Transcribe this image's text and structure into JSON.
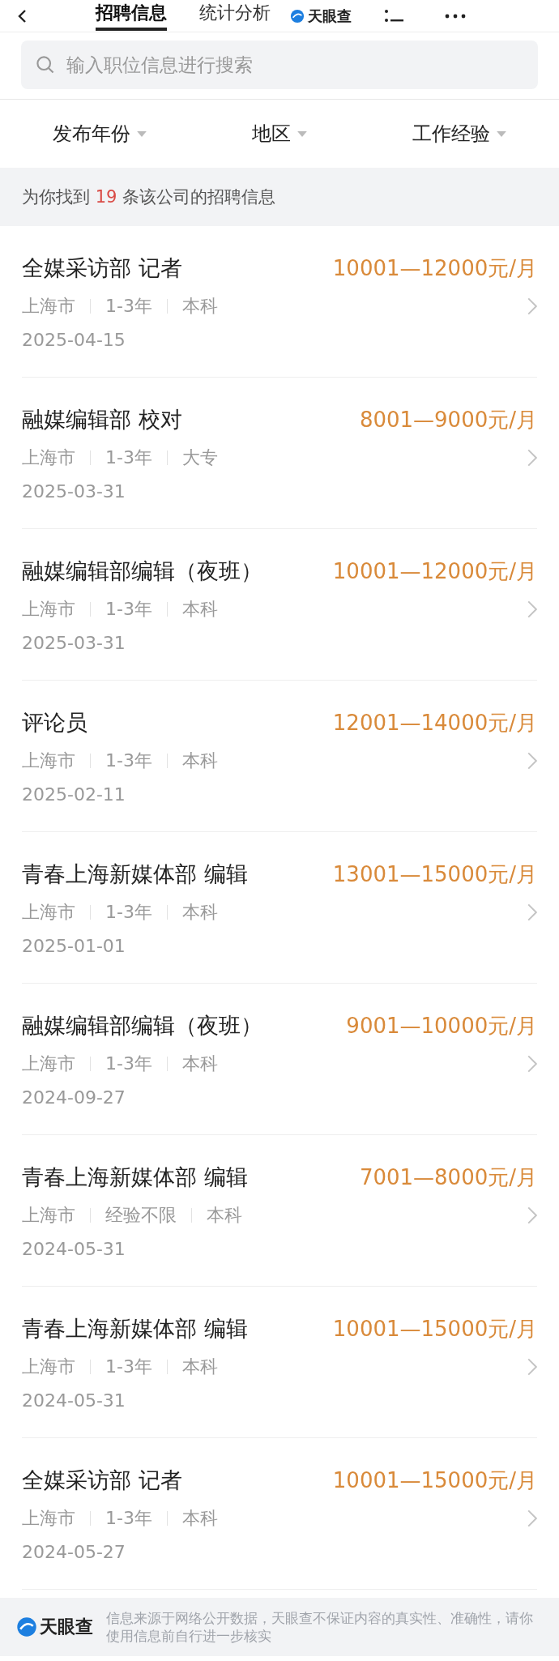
{
  "header": {
    "tabs": [
      {
        "label": "招聘信息",
        "selected": true
      },
      {
        "label": "统计分析",
        "selected": false
      }
    ],
    "logo": "天眼查"
  },
  "search": {
    "placeholder": "输入职位信息进行搜索"
  },
  "filters": [
    "发布年份",
    "地区",
    "工作经验"
  ],
  "summary": {
    "prefix": "为你找到",
    "count": "19",
    "suffix": "条该公司的招聘信息"
  },
  "jobs": [
    {
      "title": "全媒采访部 记者",
      "salary": "10001—12000元/月",
      "location": "上海市",
      "experience": "1-3年",
      "education": "本科",
      "date": "2025-04-15"
    },
    {
      "title": "融媒编辑部 校对",
      "salary": "8001—9000元/月",
      "location": "上海市",
      "experience": "1-3年",
      "education": "大专",
      "date": "2025-03-31"
    },
    {
      "title": "融媒编辑部编辑（夜班）",
      "salary": "10001—12000元/月",
      "location": "上海市",
      "experience": "1-3年",
      "education": "本科",
      "date": "2025-03-31"
    },
    {
      "title": "评论员",
      "salary": "12001—14000元/月",
      "location": "上海市",
      "experience": "1-3年",
      "education": "本科",
      "date": "2025-02-11"
    },
    {
      "title": "青春上海新媒体部 编辑",
      "salary": "13001—15000元/月",
      "location": "上海市",
      "experience": "1-3年",
      "education": "本科",
      "date": "2025-01-01"
    },
    {
      "title": "融媒编辑部编辑（夜班）",
      "salary": "9001—10000元/月",
      "location": "上海市",
      "experience": "1-3年",
      "education": "本科",
      "date": "2024-09-27"
    },
    {
      "title": "青春上海新媒体部 编辑",
      "salary": "7001—8000元/月",
      "location": "上海市",
      "experience": "经验不限",
      "education": "本科",
      "date": "2024-05-31"
    },
    {
      "title": "青春上海新媒体部 编辑",
      "salary": "10001—15000元/月",
      "location": "上海市",
      "experience": "1-3年",
      "education": "本科",
      "date": "2024-05-31"
    },
    {
      "title": "全媒采访部 记者",
      "salary": "10001—15000元/月",
      "location": "上海市",
      "experience": "1-3年",
      "education": "本科",
      "date": "2024-05-27"
    }
  ],
  "footer": {
    "logo": "天眼查",
    "notice": "信息来源于网络公开数据，天眼查不保证内容的真实性、准确性，请你使用信息前自行进一步核实"
  }
}
